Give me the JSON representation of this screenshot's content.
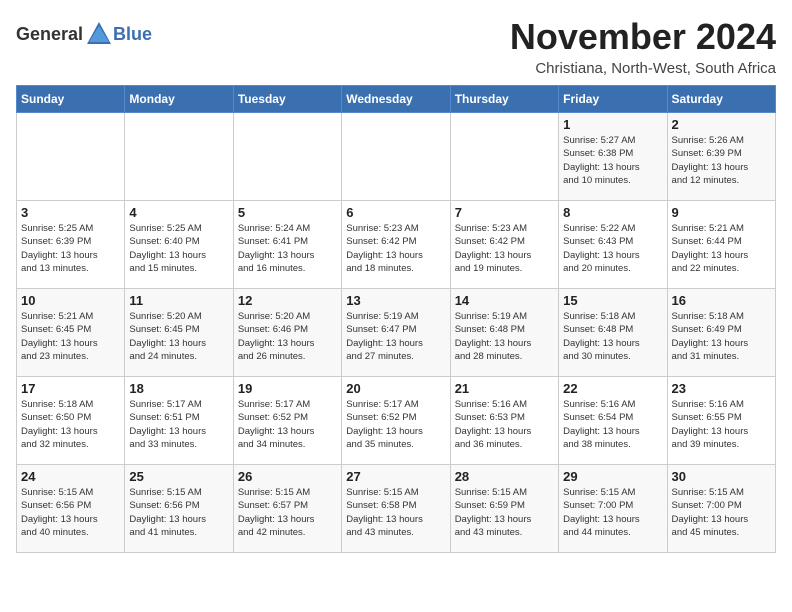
{
  "header": {
    "logo_general": "General",
    "logo_blue": "Blue",
    "title": "November 2024",
    "location": "Christiana, North-West, South Africa"
  },
  "calendar": {
    "weekdays": [
      "Sunday",
      "Monday",
      "Tuesday",
      "Wednesday",
      "Thursday",
      "Friday",
      "Saturday"
    ],
    "weeks": [
      [
        {
          "day": "",
          "info": ""
        },
        {
          "day": "",
          "info": ""
        },
        {
          "day": "",
          "info": ""
        },
        {
          "day": "",
          "info": ""
        },
        {
          "day": "",
          "info": ""
        },
        {
          "day": "1",
          "info": "Sunrise: 5:27 AM\nSunset: 6:38 PM\nDaylight: 13 hours\nand 10 minutes."
        },
        {
          "day": "2",
          "info": "Sunrise: 5:26 AM\nSunset: 6:39 PM\nDaylight: 13 hours\nand 12 minutes."
        }
      ],
      [
        {
          "day": "3",
          "info": "Sunrise: 5:25 AM\nSunset: 6:39 PM\nDaylight: 13 hours\nand 13 minutes."
        },
        {
          "day": "4",
          "info": "Sunrise: 5:25 AM\nSunset: 6:40 PM\nDaylight: 13 hours\nand 15 minutes."
        },
        {
          "day": "5",
          "info": "Sunrise: 5:24 AM\nSunset: 6:41 PM\nDaylight: 13 hours\nand 16 minutes."
        },
        {
          "day": "6",
          "info": "Sunrise: 5:23 AM\nSunset: 6:42 PM\nDaylight: 13 hours\nand 18 minutes."
        },
        {
          "day": "7",
          "info": "Sunrise: 5:23 AM\nSunset: 6:42 PM\nDaylight: 13 hours\nand 19 minutes."
        },
        {
          "day": "8",
          "info": "Sunrise: 5:22 AM\nSunset: 6:43 PM\nDaylight: 13 hours\nand 20 minutes."
        },
        {
          "day": "9",
          "info": "Sunrise: 5:21 AM\nSunset: 6:44 PM\nDaylight: 13 hours\nand 22 minutes."
        }
      ],
      [
        {
          "day": "10",
          "info": "Sunrise: 5:21 AM\nSunset: 6:45 PM\nDaylight: 13 hours\nand 23 minutes."
        },
        {
          "day": "11",
          "info": "Sunrise: 5:20 AM\nSunset: 6:45 PM\nDaylight: 13 hours\nand 24 minutes."
        },
        {
          "day": "12",
          "info": "Sunrise: 5:20 AM\nSunset: 6:46 PM\nDaylight: 13 hours\nand 26 minutes."
        },
        {
          "day": "13",
          "info": "Sunrise: 5:19 AM\nSunset: 6:47 PM\nDaylight: 13 hours\nand 27 minutes."
        },
        {
          "day": "14",
          "info": "Sunrise: 5:19 AM\nSunset: 6:48 PM\nDaylight: 13 hours\nand 28 minutes."
        },
        {
          "day": "15",
          "info": "Sunrise: 5:18 AM\nSunset: 6:48 PM\nDaylight: 13 hours\nand 30 minutes."
        },
        {
          "day": "16",
          "info": "Sunrise: 5:18 AM\nSunset: 6:49 PM\nDaylight: 13 hours\nand 31 minutes."
        }
      ],
      [
        {
          "day": "17",
          "info": "Sunrise: 5:18 AM\nSunset: 6:50 PM\nDaylight: 13 hours\nand 32 minutes."
        },
        {
          "day": "18",
          "info": "Sunrise: 5:17 AM\nSunset: 6:51 PM\nDaylight: 13 hours\nand 33 minutes."
        },
        {
          "day": "19",
          "info": "Sunrise: 5:17 AM\nSunset: 6:52 PM\nDaylight: 13 hours\nand 34 minutes."
        },
        {
          "day": "20",
          "info": "Sunrise: 5:17 AM\nSunset: 6:52 PM\nDaylight: 13 hours\nand 35 minutes."
        },
        {
          "day": "21",
          "info": "Sunrise: 5:16 AM\nSunset: 6:53 PM\nDaylight: 13 hours\nand 36 minutes."
        },
        {
          "day": "22",
          "info": "Sunrise: 5:16 AM\nSunset: 6:54 PM\nDaylight: 13 hours\nand 38 minutes."
        },
        {
          "day": "23",
          "info": "Sunrise: 5:16 AM\nSunset: 6:55 PM\nDaylight: 13 hours\nand 39 minutes."
        }
      ],
      [
        {
          "day": "24",
          "info": "Sunrise: 5:15 AM\nSunset: 6:56 PM\nDaylight: 13 hours\nand 40 minutes."
        },
        {
          "day": "25",
          "info": "Sunrise: 5:15 AM\nSunset: 6:56 PM\nDaylight: 13 hours\nand 41 minutes."
        },
        {
          "day": "26",
          "info": "Sunrise: 5:15 AM\nSunset: 6:57 PM\nDaylight: 13 hours\nand 42 minutes."
        },
        {
          "day": "27",
          "info": "Sunrise: 5:15 AM\nSunset: 6:58 PM\nDaylight: 13 hours\nand 43 minutes."
        },
        {
          "day": "28",
          "info": "Sunrise: 5:15 AM\nSunset: 6:59 PM\nDaylight: 13 hours\nand 43 minutes."
        },
        {
          "day": "29",
          "info": "Sunrise: 5:15 AM\nSunset: 7:00 PM\nDaylight: 13 hours\nand 44 minutes."
        },
        {
          "day": "30",
          "info": "Sunrise: 5:15 AM\nSunset: 7:00 PM\nDaylight: 13 hours\nand 45 minutes."
        }
      ]
    ]
  }
}
